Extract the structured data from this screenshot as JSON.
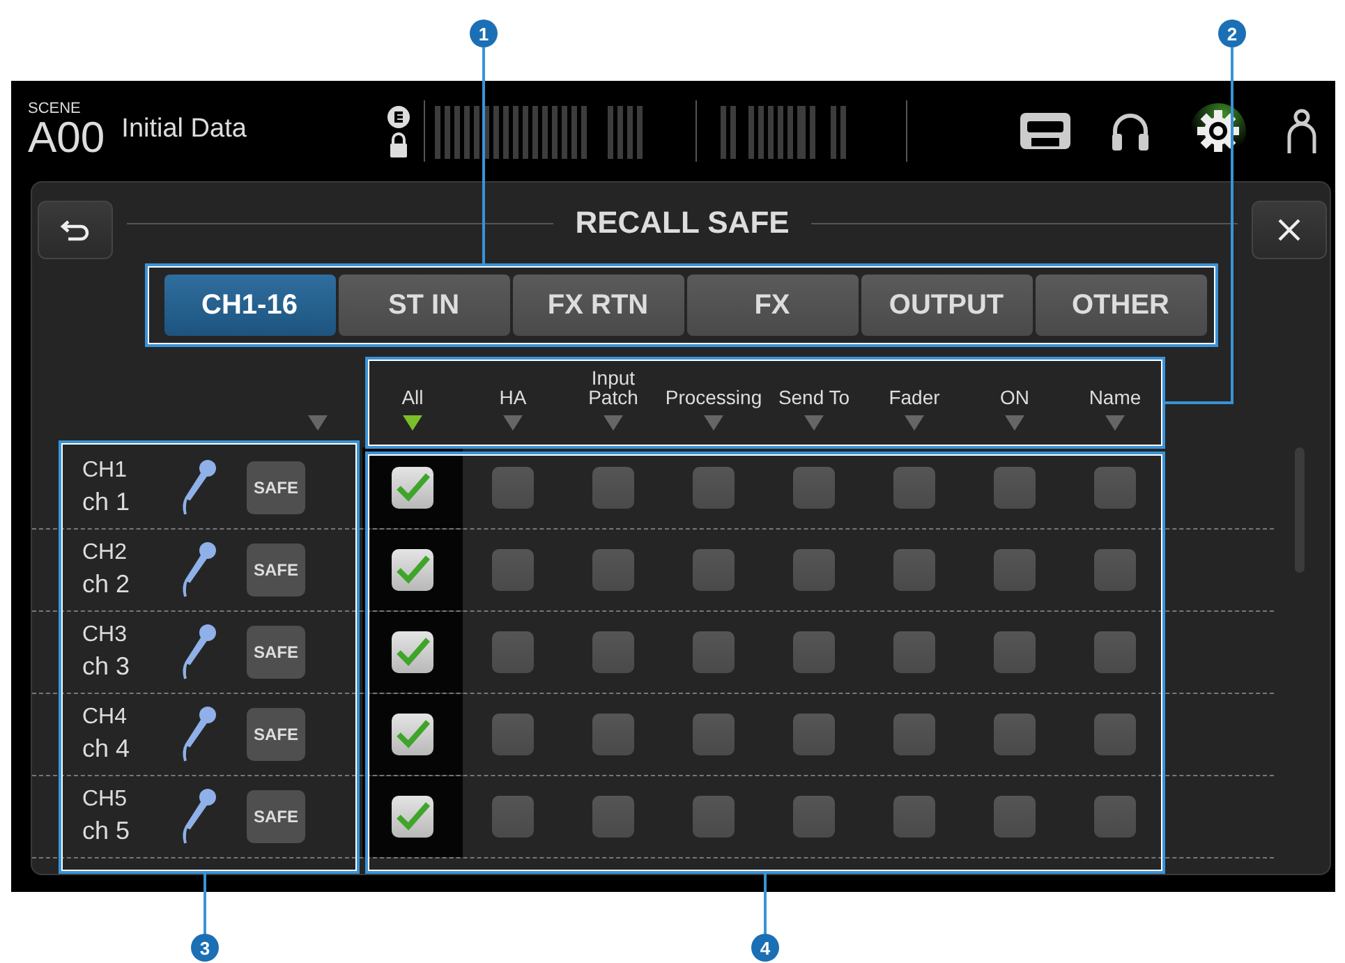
{
  "header": {
    "scene_label": "SCENE",
    "scene_number": "A00",
    "scene_name": "Initial Data",
    "settings_active": true
  },
  "panel": {
    "title": "RECALL SAFE"
  },
  "tabs": [
    {
      "label": "CH1-16",
      "selected": true
    },
    {
      "label": "ST IN",
      "selected": false
    },
    {
      "label": "FX RTN",
      "selected": false
    },
    {
      "label": "FX",
      "selected": false
    },
    {
      "label": "OUTPUT",
      "selected": false
    },
    {
      "label": "OTHER",
      "selected": false
    }
  ],
  "columns": [
    {
      "label": "All",
      "selected": true
    },
    {
      "label": "HA",
      "selected": false
    },
    {
      "label": "Input Patch",
      "selected": false
    },
    {
      "label": "Processing",
      "selected": false
    },
    {
      "label": "Send To",
      "selected": false
    },
    {
      "label": "Fader",
      "selected": false
    },
    {
      "label": "ON",
      "selected": false
    },
    {
      "label": "Name",
      "selected": false
    }
  ],
  "channels": [
    {
      "id": "CH1",
      "name": "ch 1",
      "safe_label": "SAFE",
      "safe_on": false,
      "checks": [
        true,
        false,
        false,
        false,
        false,
        false,
        false,
        false
      ]
    },
    {
      "id": "CH2",
      "name": "ch 2",
      "safe_label": "SAFE",
      "safe_on": false,
      "checks": [
        true,
        false,
        false,
        false,
        false,
        false,
        false,
        false
      ]
    },
    {
      "id": "CH3",
      "name": "ch 3",
      "safe_label": "SAFE",
      "safe_on": false,
      "checks": [
        true,
        false,
        false,
        false,
        false,
        false,
        false,
        false
      ]
    },
    {
      "id": "CH4",
      "name": "ch 4",
      "safe_label": "SAFE",
      "safe_on": false,
      "checks": [
        true,
        false,
        false,
        false,
        false,
        false,
        false,
        false
      ]
    },
    {
      "id": "CH5",
      "name": "ch 5",
      "safe_label": "SAFE",
      "safe_on": false,
      "checks": [
        true,
        false,
        false,
        false,
        false,
        false,
        false,
        false
      ]
    }
  ],
  "callouts": [
    "1",
    "2",
    "3",
    "4"
  ]
}
